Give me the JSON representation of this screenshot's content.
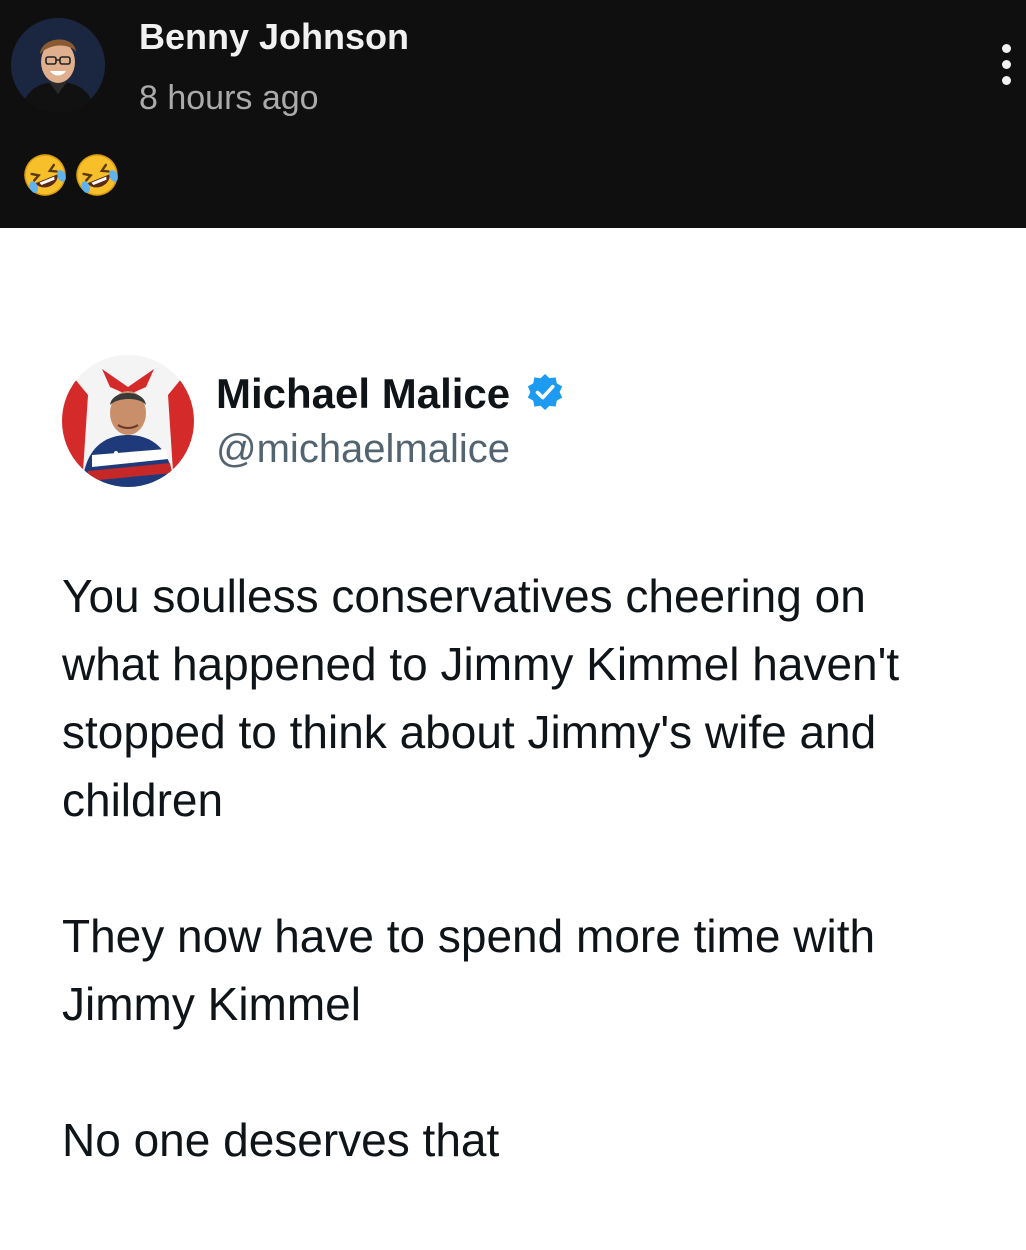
{
  "post": {
    "author_name": "Benny Johnson",
    "timestamp": "8 hours ago",
    "caption_emojis": [
      "rolling-on-floor-laughing",
      "rolling-on-floor-laughing"
    ],
    "menu_icon": "vertical-ellipsis-icon"
  },
  "tweet": {
    "display_name": "Michael Malice",
    "handle": "@michaelmalice",
    "verified": true,
    "verified_color": "#1d9bf0",
    "paragraphs": [
      "You soulless conservatives cheering on\nwhat happened to Jimmy Kimmel haven't\nstopped to think about Jimmy's wife and\nchildren",
      "They now have to spend more time with\nJimmy Kimmel",
      "No one deserves that"
    ]
  },
  "colors": {
    "header_bg": "#0f0f0f",
    "header_text": "#f1f1f1",
    "header_subtext": "#aaaaaa",
    "card_bg": "#ffffff",
    "tweet_text": "#0f1419",
    "tweet_handle": "#536471"
  }
}
